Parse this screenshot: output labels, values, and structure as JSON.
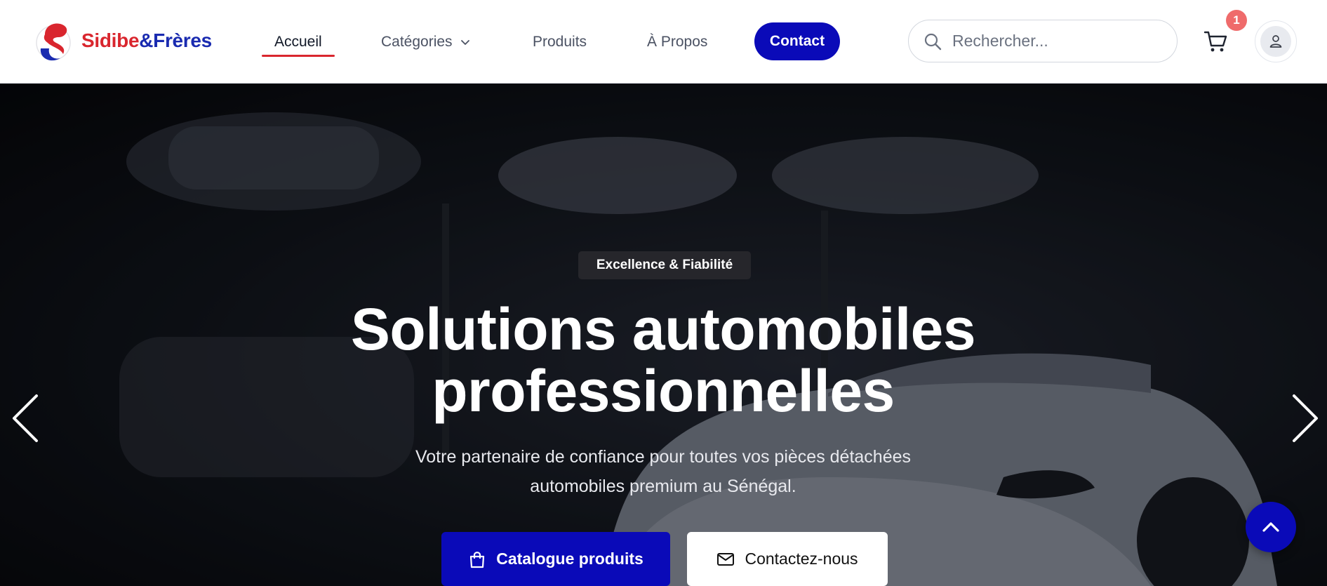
{
  "brand": {
    "name_part1": "Sidibe",
    "name_part2": "&Frères",
    "red": "#d9262e",
    "blue": "#1a2bb0"
  },
  "nav": {
    "items": [
      {
        "label": "Accueil",
        "active": true
      },
      {
        "label": "Catégories",
        "dropdown": true
      },
      {
        "label": "Produits"
      },
      {
        "label": "À Propos"
      }
    ],
    "contact_label": "Contact"
  },
  "search": {
    "placeholder": "Rechercher..."
  },
  "cart": {
    "count": "1"
  },
  "hero": {
    "badge": "Excellence & Fiabilité",
    "title_line1": "Solutions automobiles",
    "title_line2": "professionnelles",
    "subtitle_line1": "Votre partenaire de confiance pour toutes vos pièces détachées",
    "subtitle_line2": "automobiles premium au Sénégal.",
    "cta_primary": "Catalogue produits",
    "cta_secondary": "Contactez-nous"
  },
  "colors": {
    "accent": "#0a0ab8",
    "badge": "#ef6b6b"
  },
  "icons": [
    "logo-icon",
    "chevron-down-icon",
    "search-icon",
    "cart-icon",
    "user-icon",
    "shopping-bag-icon",
    "mail-icon",
    "chevron-left-icon",
    "chevron-right-icon",
    "arrow-up-icon"
  ]
}
